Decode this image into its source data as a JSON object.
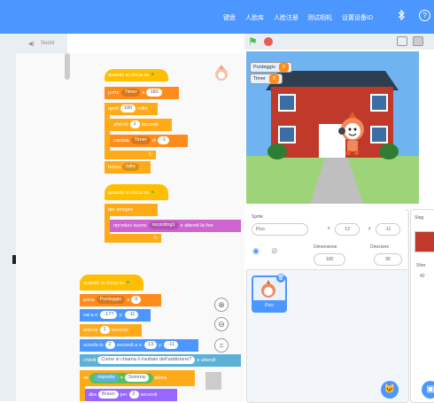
{
  "topbar": {
    "items": [
      "键盘",
      "人脸库",
      "人脸注册",
      "测试相机",
      "设置设备ID"
    ],
    "help_icon": "?"
  },
  "left_tab": {
    "sounds_label": "Suoni"
  },
  "blocks": {
    "script1": {
      "hat": "quando si clicca su",
      "set_var": "porta",
      "set_var_name": "Timer",
      "set_var_to": "a",
      "set_var_val": "180",
      "repeat": "ripeti",
      "repeat_n": "180",
      "repeat_suffix": "volte",
      "wait": "attendi",
      "wait_n": "1",
      "wait_suffix": "secondi",
      "change": "cambia",
      "change_var": "Timer",
      "change_by": "di",
      "change_val": "-1",
      "stop": "ferma",
      "stop_opt": "tutto"
    },
    "script2": {
      "hat": "quando si clicca su",
      "forever": "per sempre",
      "play": "riproduci suono",
      "play_sound": "recording1",
      "play_suffix": "e attendi la fine"
    },
    "script3": {
      "hat": "quando si clicca su",
      "set_var": "porta",
      "set_var_name": "Punteggio",
      "set_var_to": "a",
      "set_var_val": "0",
      "goto": "vai a x:",
      "goto_x": "-177",
      "goto_y_label": "y:",
      "goto_y": "-11",
      "wait": "attendi",
      "wait_n": "1",
      "wait_suffix": "secondi",
      "glide": "scivola in",
      "glide_n": "2",
      "glide_mid": "secondi a x:",
      "glide_x": "13",
      "glide_y_label": "y:",
      "glide_y": "-11",
      "ask": "chiedi",
      "ask_q": "Come si chiama il risultato dell'addizione?",
      "ask_suffix": "e attendi",
      "if": "se",
      "if_left": "risposta",
      "if_op": "=",
      "if_right": "Somma",
      "if_then": "allora",
      "say": "dire",
      "say_text": "Bravo",
      "say_for": "per",
      "say_n": "2",
      "say_suffix": "secondi"
    }
  },
  "zoom": {
    "zoom_in": "+",
    "zoom_out": "−",
    "reset": "="
  },
  "stage": {
    "monitors": [
      {
        "label": "Punteggio",
        "value": "0"
      },
      {
        "label": "Timer",
        "value": "0"
      }
    ]
  },
  "sprite_info": {
    "sprite_label": "Sprite",
    "sprite_name": "Pico",
    "x_label": "x",
    "x_value": "13",
    "y_label": "y",
    "y_value": "-11",
    "size_label": "Dimensione",
    "size_value": "100",
    "direction_label": "Direzione",
    "direction_value": "90"
  },
  "sprite_list": [
    {
      "name": "Pico"
    }
  ],
  "stage_pane": {
    "label": "Stag",
    "backdrops_label": "Sfon",
    "backdrops_count": "42"
  },
  "colors": {
    "accent": "#4c97ff",
    "events": "#ffbf00",
    "control": "#ffab19",
    "variables": "#ff8c1a",
    "motion": "#4c97ff",
    "sound": "#cf63cf",
    "sensing": "#5cb1d6",
    "operators": "#59c059",
    "looks": "#9966ff"
  }
}
